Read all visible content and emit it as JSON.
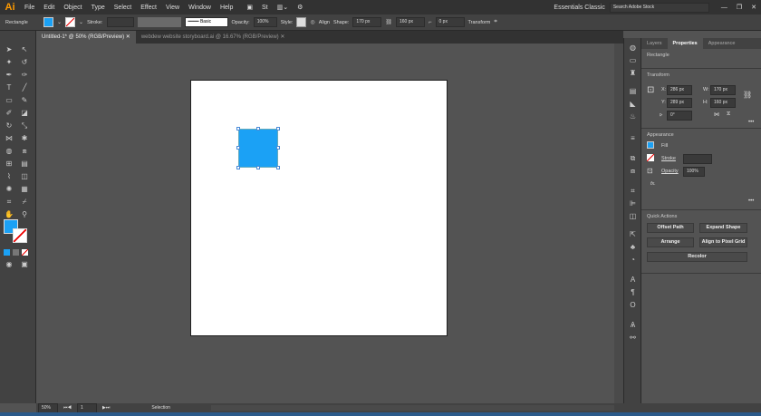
{
  "app": {
    "logo": "Ai",
    "menu": [
      "File",
      "Edit",
      "Object",
      "Type",
      "Select",
      "Effect",
      "View",
      "Window",
      "Help"
    ],
    "workspace": "Essentials Classic",
    "search_placeholder": "Search Adobe Stock"
  },
  "control": {
    "object_type": "Rectangle",
    "stroke_label": "Stroke:",
    "brush": "Basic",
    "opacity_label": "Opacity:",
    "opacity": "100%",
    "style_label": "Style:",
    "align_label": "Align",
    "shape_label": "Shape:",
    "width": "170 px",
    "height": "160 px",
    "corner": "0 px",
    "transform_label": "Transform",
    "fill_color": "#1ba1f5"
  },
  "tabs": [
    {
      "label": "Untitled-1* @ 50% (RGB/Preview)",
      "active": true
    },
    {
      "label": "webdew website storyboard.ai @ 16.67% (RGB/Preview)",
      "active": false
    }
  ],
  "panel": {
    "tabs": [
      "Layers",
      "Properties",
      "Appearance"
    ],
    "object": "Rectangle",
    "transform": {
      "title": "Transform",
      "x_label": "X:",
      "x": "286 px",
      "y_label": "Y:",
      "y": "289 px",
      "w_label": "W:",
      "w": "170 px",
      "h_label": "H:",
      "h": "160 px",
      "angle": "0°"
    },
    "appearance": {
      "title": "Appearance",
      "fill": "Fill",
      "stroke": "Stroke",
      "opacity_label": "Opacity",
      "opacity": "100%",
      "fx": "fx."
    },
    "quick_actions": {
      "title": "Quick Actions",
      "offset_path": "Offset Path",
      "expand_shape": "Expand Shape",
      "arrange": "Arrange",
      "align_pixel": "Align to Pixel Grid",
      "recolor": "Recolor"
    }
  },
  "status": {
    "zoom": "50%",
    "artboard": "1",
    "tool": "Selection"
  }
}
